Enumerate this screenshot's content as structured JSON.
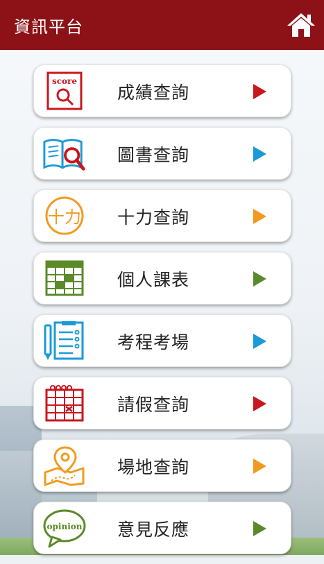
{
  "header": {
    "title": "資訊平台",
    "home_icon": "home-icon"
  },
  "menu": {
    "items": [
      {
        "label": "成績查詢",
        "icon": "score-search-icon",
        "arrow_color": "#c8171e"
      },
      {
        "label": "圖書查詢",
        "icon": "book-search-icon",
        "arrow_color": "#1a9ad6"
      },
      {
        "label": "十力查詢",
        "icon": "ten-power-icon",
        "arrow_color": "#f29a1f"
      },
      {
        "label": "個人課表",
        "icon": "timetable-icon",
        "arrow_color": "#5b8a2a"
      },
      {
        "label": "考程考場",
        "icon": "exam-schedule-icon",
        "arrow_color": "#1a9ad6"
      },
      {
        "label": "請假查詢",
        "icon": "leave-calendar-icon",
        "arrow_color": "#c8171e"
      },
      {
        "label": "場地查詢",
        "icon": "venue-map-icon",
        "arrow_color": "#f29a1f"
      },
      {
        "label": "意見反應",
        "icon": "opinion-bubble-icon",
        "arrow_color": "#5b8a2a"
      }
    ],
    "score_icon_text": "score",
    "opinion_icon_text": "opinion",
    "ten_power_icon_text": "十力"
  },
  "colors": {
    "header_bg": "#8c1217",
    "title_text": "#ffffff"
  }
}
